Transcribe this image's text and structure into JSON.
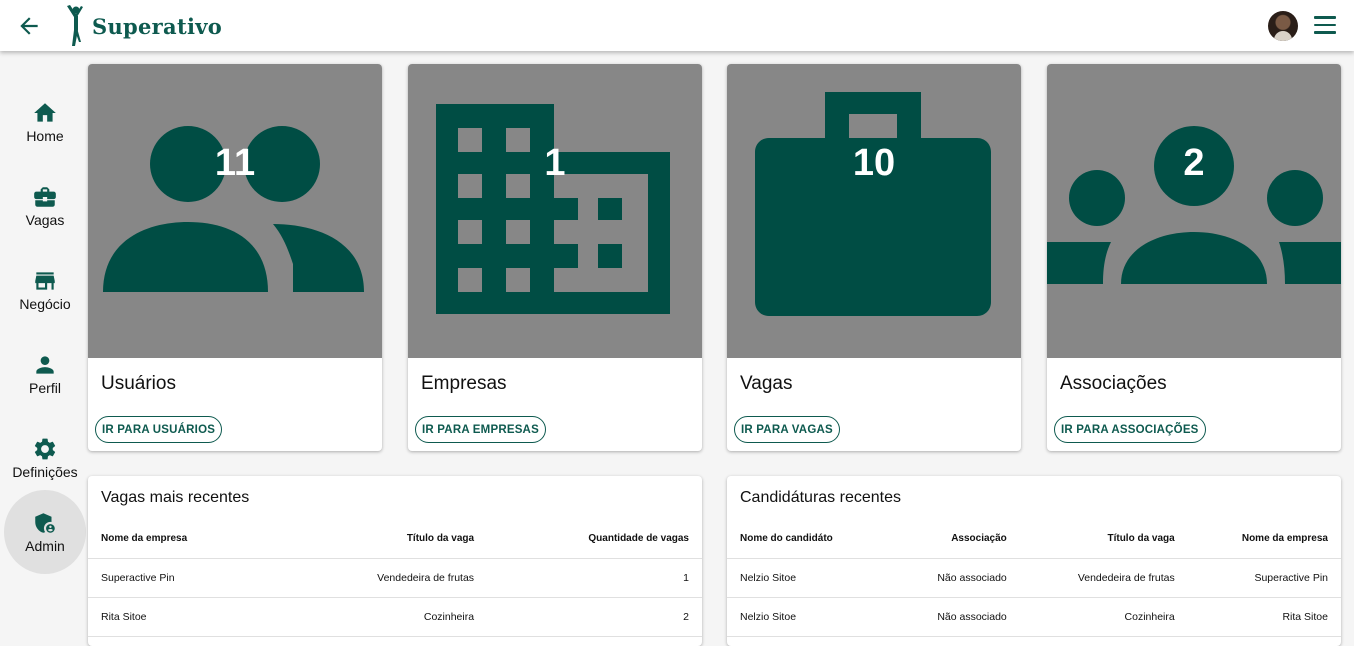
{
  "header": {
    "app_title": "Superativo"
  },
  "sidebar": {
    "items": [
      {
        "label": "Home",
        "icon": "home-icon"
      },
      {
        "label": "Vagas",
        "icon": "briefcase-icon"
      },
      {
        "label": "Negócio",
        "icon": "store-icon"
      },
      {
        "label": "Perfil",
        "icon": "person-icon"
      },
      {
        "label": "Definições",
        "icon": "gear-icon"
      },
      {
        "label": "Admin",
        "icon": "admin-shield-icon",
        "active": true
      }
    ]
  },
  "cards": [
    {
      "count": "11",
      "title": "Usuários",
      "button": "IR PARA USUÁRIOS",
      "icon": "users-icon"
    },
    {
      "count": "1",
      "title": "Empresas",
      "button": "IR PARA EMPRESAS",
      "icon": "building-icon"
    },
    {
      "count": "10",
      "title": "Vagas",
      "button": "IR PARA VAGAS",
      "icon": "briefcase-icon"
    },
    {
      "count": "2",
      "title": "Associações",
      "button": "IR PARA ASSOCIAÇÕES",
      "icon": "groups-icon"
    }
  ],
  "recent_jobs": {
    "title": "Vagas mais recentes",
    "columns": [
      "Nome da empresa",
      "Título da vaga",
      "Quantidade de vagas"
    ],
    "rows": [
      [
        "Superactive Pin",
        "Vendedeira de frutas",
        "1"
      ],
      [
        "Rita Sitoe",
        "Cozinheira",
        "2"
      ]
    ]
  },
  "recent_applications": {
    "title": "Candidáturas recentes",
    "columns": [
      "Nome do candidáto",
      "Associação",
      "Título da vaga",
      "Nome da empresa"
    ],
    "rows": [
      [
        "Nelzio Sitoe",
        "Não associado",
        "Vendedeira de frutas",
        "Superactive Pin"
      ],
      [
        "Nelzio Sitoe",
        "Não associado",
        "Cozinheira",
        "Rita Sitoe"
      ]
    ]
  },
  "colors": {
    "brand": "#0e5a4f",
    "card_media_bg": "#878787",
    "icon_fill": "#004d44"
  }
}
